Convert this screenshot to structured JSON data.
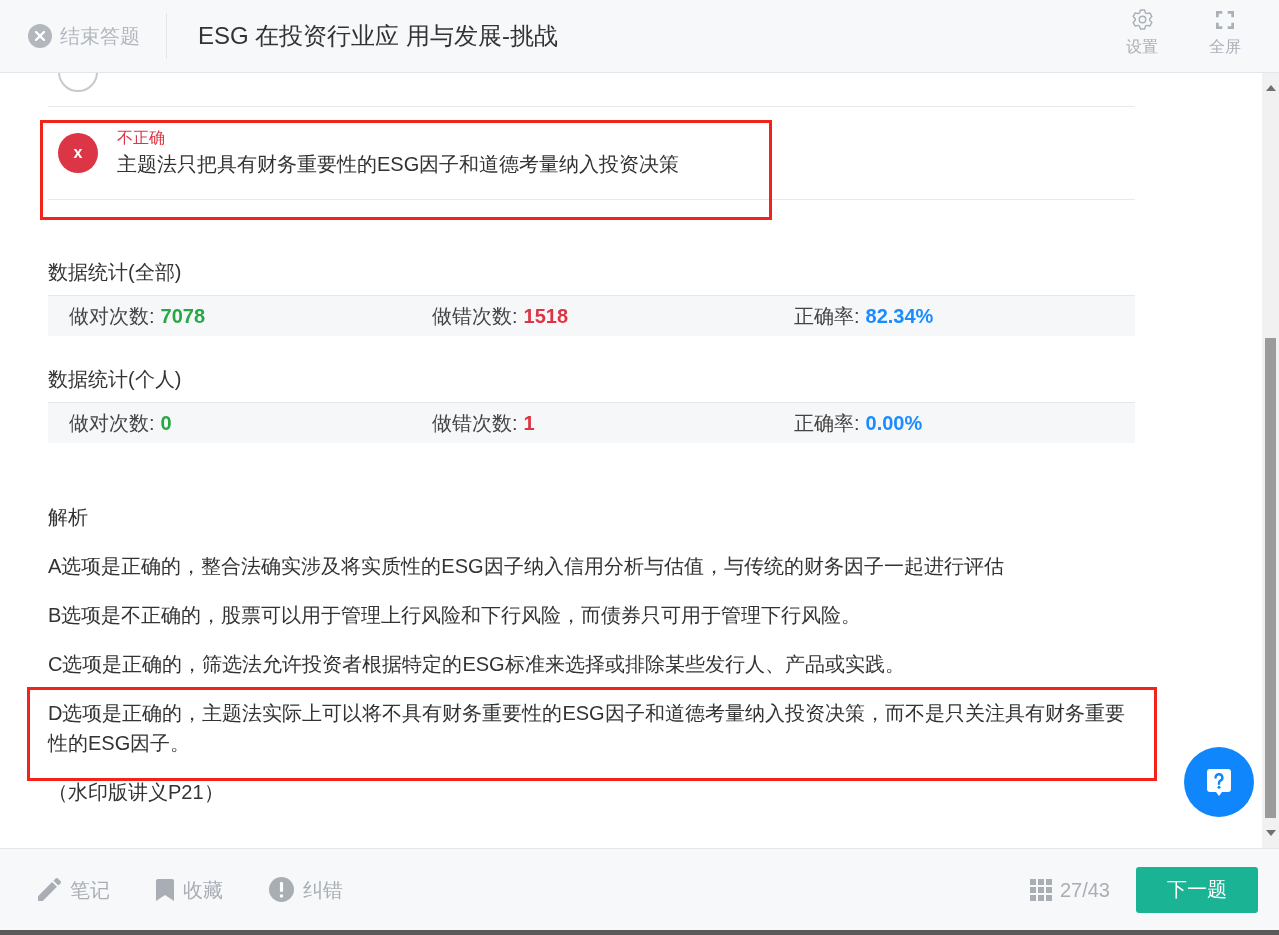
{
  "header": {
    "exit_label": "结束答题",
    "title": "ESG 在投资行业应 用与发展-挑战",
    "actions": [
      {
        "kind": "settings",
        "label": "设置"
      },
      {
        "kind": "fullscreen",
        "label": "全屏"
      }
    ]
  },
  "options": [
    {
      "kind": "option",
      "highlighted": false
    },
    {
      "kind": "wrong",
      "badge": "x",
      "verdict": "不正确",
      "text": "主题法只把具有财务重要性的ESG因子和道德考量纳入投资决策",
      "highlighted": true
    }
  ],
  "stats": [
    {
      "title": "数据统计(全部)",
      "items": [
        {
          "kind": "correct",
          "label": "做对次数:",
          "value": "7078"
        },
        {
          "kind": "wrong",
          "label": "做错次数:",
          "value": "1518"
        },
        {
          "kind": "rate",
          "label": "正确率:",
          "value": "82.34%"
        }
      ]
    },
    {
      "title": "数据统计(个人)",
      "items": [
        {
          "kind": "correct",
          "label": "做对次数:",
          "value": "0"
        },
        {
          "kind": "wrong",
          "label": "做错次数:",
          "value": "1"
        },
        {
          "kind": "rate",
          "label": "正确率:",
          "value": "0.00%"
        }
      ]
    }
  ],
  "analysis": {
    "title": "解析",
    "paragraphs": [
      {
        "text": "A选项是正确的，整合法确实涉及将实质性的ESG因子纳入信用分析与估值，与传统的财务因子一起进行评估",
        "highlighted": false
      },
      {
        "text": "B选项是不正确的，股票可以用于管理上行风险和下行风险，而债券只可用于管理下行风险。",
        "highlighted": false
      },
      {
        "text": "C选项是正确的，筛选法允许投资者根据特定的ESG标准来选择或排除某些发行人、产品或实践。",
        "highlighted": false
      },
      {
        "text": "D选项是正确的，主题法实际上可以将不具有财务重要性的ESG因子和道德考量纳入投资决策，而不是只关注具有财务重要性的ESG因子。",
        "highlighted": true
      }
    ],
    "source": "（水印版讲义P21）"
  },
  "footer": {
    "tools": [
      {
        "kind": "note",
        "label": "笔记"
      },
      {
        "kind": "bookmark",
        "label": "收藏"
      },
      {
        "kind": "report",
        "label": "纠错"
      }
    ],
    "progress": "27/43",
    "next_label": "下一题"
  }
}
